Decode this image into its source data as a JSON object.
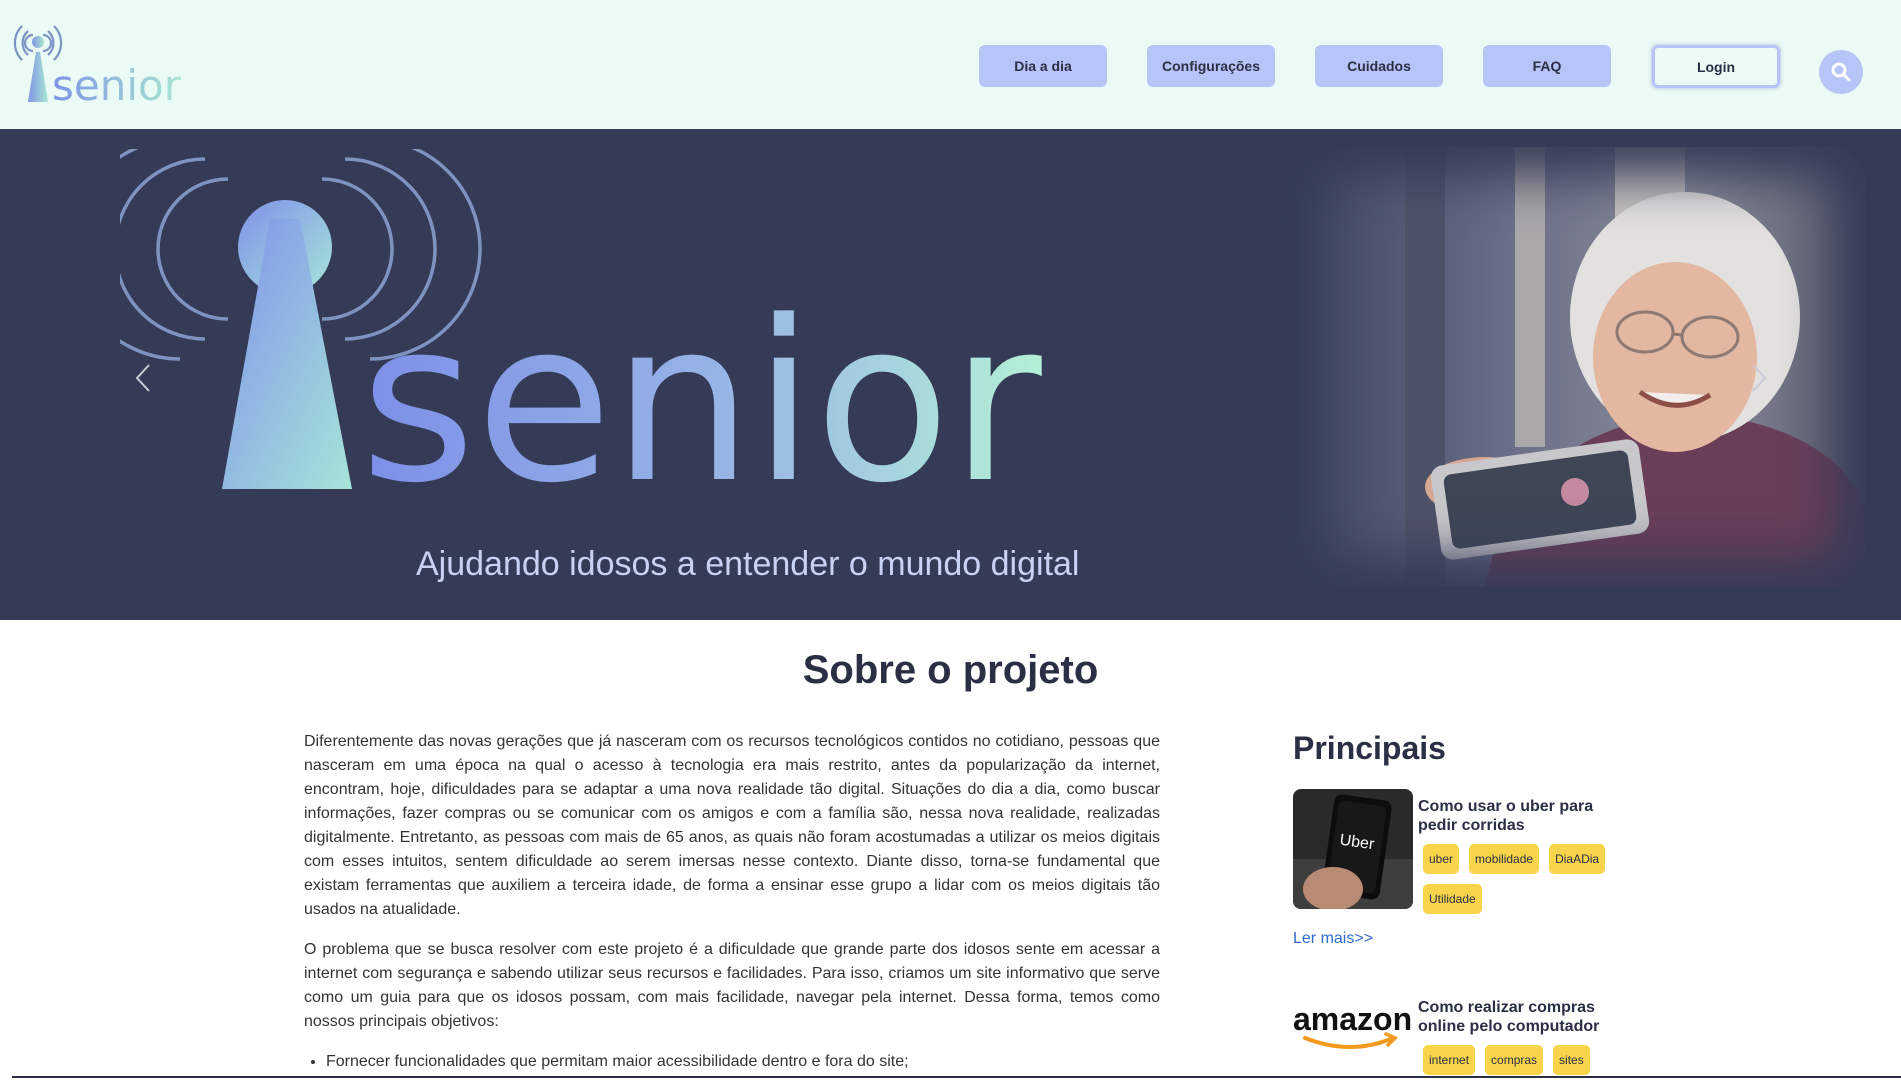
{
  "header": {
    "logo_text": "senior",
    "nav": [
      {
        "label": "Dia a dia"
      },
      {
        "label": "Configurações"
      },
      {
        "label": "Cuidados"
      },
      {
        "label": "FAQ"
      }
    ],
    "login_label": "Login",
    "search_icon": "search-icon"
  },
  "hero": {
    "logo_text": "senior",
    "tagline": "Ajudando idosos a entender o mundo digital",
    "prev_icon": "chevron-left-icon",
    "next_icon": "chevron-right-icon"
  },
  "about": {
    "title": "Sobre o projeto",
    "paragraphs": [
      "Diferentemente das novas gerações que já nasceram com os recursos tecnológicos contidos no cotidiano, pessoas que nasceram em uma época na qual o acesso à tecnologia era mais restrito, antes da popularização da internet, encontram, hoje, dificuldades para se adaptar a uma nova realidade tão digital. Situações do dia a dia, como buscar informações, fazer compras ou se comunicar com os amigos e com a família são, nessa nova realidade, realizadas digitalmente. Entretanto, as pessoas com mais de 65 anos, as quais não foram acostumadas a utilizar os meios digitais com esses intuitos, sentem dificuldade ao serem imersas nesse contexto. Diante disso, torna-se fundamental que existam ferramentas que auxiliem a terceira idade, de forma a ensinar esse grupo a lidar com os meios digitais tão usados na atualidade.",
      "O problema que se busca resolver com este projeto é a dificuldade que grande parte dos idosos sente em acessar a internet com segurança e sabendo utilizar seus recursos e facilidades. Para isso, criamos um site informativo que serve como um guia para que os idosos possam, com mais facilidade, navegar pela internet. Dessa forma, temos como nossos principais objetivos:"
    ],
    "objectives": [
      "Fornecer funcionalidades que permitam maior acessibilidade dentro e fora do site;"
    ]
  },
  "sidebar": {
    "title": "Principais",
    "posts": [
      {
        "title": "Como usar o uber para pedir corridas",
        "thumb_text": "Uber",
        "tags": [
          "uber",
          "mobilidade",
          "DiaADia",
          "Utilidade"
        ]
      },
      {
        "title": "Como realizar compras online pelo computador",
        "thumb_text": "amazon",
        "tags": [
          "internet",
          "compras",
          "sites"
        ]
      }
    ],
    "read_more": "Ler mais>>"
  },
  "colors": {
    "header_bg": "#eafaf4",
    "nav_button": "#b6c4f7",
    "hero_bg": "#353b56",
    "tag": "#f8d44a",
    "link": "#2f6cd4"
  }
}
